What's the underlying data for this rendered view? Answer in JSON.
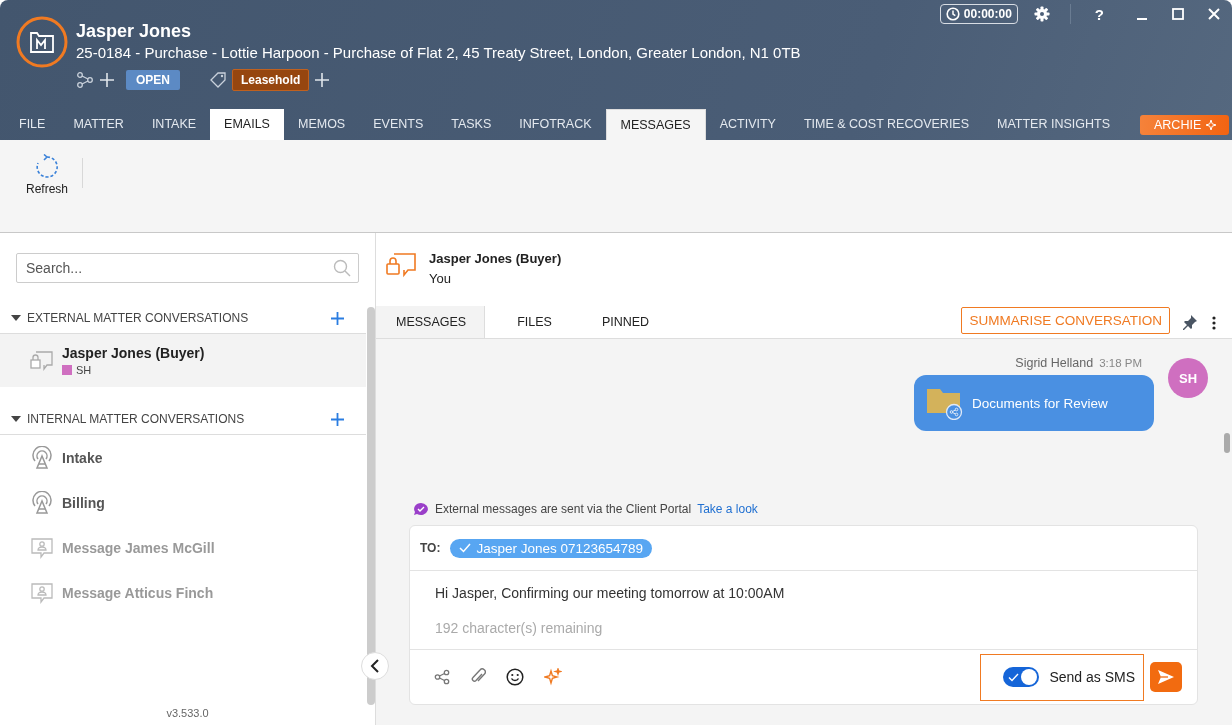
{
  "window": {
    "title": "Jasper Jones",
    "subtitle": "25-0184 - Purchase - Lottie Harpoon - Purchase of Flat 2, 45 Treaty Street, London, Greater London, N1 0TB",
    "status": "OPEN",
    "tag": "Leasehold",
    "timer": "00:00:00",
    "help": "?"
  },
  "tabs": [
    {
      "label": "FILE",
      "selected": false,
      "highlighted": false
    },
    {
      "label": "MATTER",
      "selected": false,
      "highlighted": false
    },
    {
      "label": "INTAKE",
      "selected": false,
      "highlighted": false
    },
    {
      "label": "EMAILS",
      "selected": false,
      "highlighted": true
    },
    {
      "label": "MEMOS",
      "selected": false,
      "highlighted": false
    },
    {
      "label": "EVENTS",
      "selected": false,
      "highlighted": false
    },
    {
      "label": "TASKS",
      "selected": false,
      "highlighted": false
    },
    {
      "label": "INFOTRACK",
      "selected": false,
      "highlighted": false
    },
    {
      "label": "MESSAGES",
      "selected": true,
      "highlighted": false
    },
    {
      "label": "ACTIVITY",
      "selected": false,
      "highlighted": false
    },
    {
      "label": "TIME & COST RECOVERIES",
      "selected": false,
      "highlighted": false
    },
    {
      "label": "MATTER INSIGHTS",
      "selected": false,
      "highlighted": false
    }
  ],
  "archie": {
    "label": "ARCHIE"
  },
  "ribbon": {
    "buttons": [
      {
        "label": "Refresh"
      }
    ]
  },
  "sidebar": {
    "search": {
      "placeholder": "Search..."
    },
    "sections": [
      {
        "title": "EXTERNAL MATTER CONVERSATIONS",
        "expanded": true,
        "items": [
          {
            "name": "Jasper Jones (Buyer)",
            "kind": "portal",
            "selected": true,
            "disabled": false,
            "participants": [
              {
                "initials": "SH",
                "color": "#cf6fc0"
              }
            ]
          }
        ]
      },
      {
        "title": "INTERNAL MATTER CONVERSATIONS",
        "expanded": true,
        "items": [
          {
            "name": "Intake",
            "kind": "channel",
            "selected": false,
            "disabled": false
          },
          {
            "name": "Billing",
            "kind": "channel",
            "selected": false,
            "disabled": false
          },
          {
            "name": "Message James McGill",
            "kind": "direct",
            "selected": false,
            "disabled": true
          },
          {
            "name": "Message Atticus Finch",
            "kind": "direct",
            "selected": false,
            "disabled": true
          }
        ]
      }
    ],
    "version": "v3.533.0"
  },
  "conversation": {
    "title": "Jasper Jones (Buyer)",
    "subtitle": "You",
    "tabs": [
      {
        "label": "MESSAGES",
        "selected": true
      },
      {
        "label": "FILES",
        "selected": false
      },
      {
        "label": "PINNED",
        "selected": false
      }
    ],
    "summarise": "SUMMARISE CONVERSATION",
    "messages": [
      {
        "sender": "Sigrid Helland",
        "time": "3:18 PM",
        "initials": "SH",
        "color": "#cf6fc0",
        "kind": "folder",
        "text": "Documents for Review"
      }
    ],
    "notice": "External messages are sent via the Client Portal",
    "notice_link": "Take a look",
    "composer": {
      "to_label": "TO:",
      "recipients": [
        {
          "label": "Jasper Jones 07123654789",
          "selected": true
        }
      ],
      "text": "Hi Jasper, Confirming our meeting tomorrow at 10:00AM",
      "remaining": "192 character(s) remaining",
      "sms": {
        "label": "Send as SMS",
        "on": true
      }
    }
  }
}
